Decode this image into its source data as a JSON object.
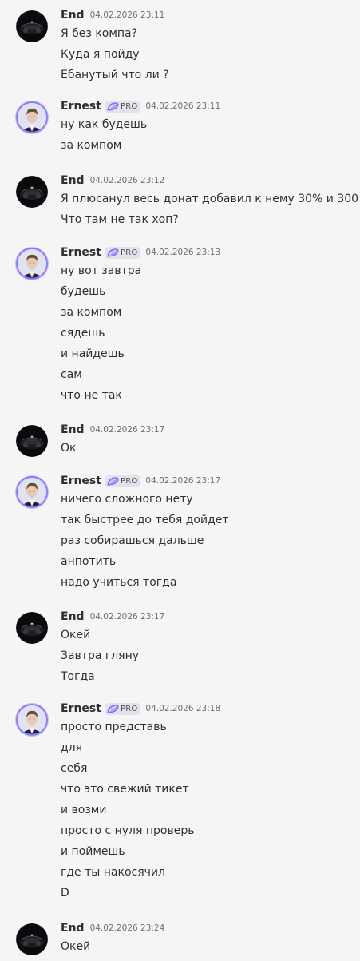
{
  "badge_label": "PRO",
  "messages": [
    {
      "author": "End",
      "timestamp": "04.02.2026 23:11",
      "lines": [
        "Я без компа?",
        "Куда я пойду",
        "Ебанутый что ли ?"
      ]
    },
    {
      "author": "Ernest",
      "pro": true,
      "timestamp": "04.02.2026 23:11",
      "lines": [
        "ну как будешь",
        "за компом"
      ]
    },
    {
      "author": "End",
      "timestamp": "04.02.2026 23:12",
      "lines": [
        "Я плюсанул весь донат добавил к нему 30% и 300",
        "Что там не так хоп?"
      ]
    },
    {
      "author": "Ernest",
      "pro": true,
      "timestamp": "04.02.2026 23:13",
      "lines": [
        "ну вот завтра",
        "будешь",
        "за компом",
        "сядешь",
        "и найдешь",
        "сам",
        "что не так"
      ]
    },
    {
      "author": "End",
      "timestamp": "04.02.2026 23:17",
      "lines": [
        "Ок"
      ]
    },
    {
      "author": "Ernest",
      "pro": true,
      "timestamp": "04.02.2026 23:17",
      "lines": [
        "ничего сложного нету",
        "так быстрее до тебя дойдет",
        "раз собирашься дальше",
        "анпотить",
        "надо учиться тогда"
      ]
    },
    {
      "author": "End",
      "timestamp": "04.02.2026 23:17",
      "lines": [
        "Окей",
        "Завтра гляну",
        "Тогда"
      ]
    },
    {
      "author": "Ernest",
      "pro": true,
      "timestamp": "04.02.2026 23:18",
      "lines": [
        "просто представь",
        "для",
        "себя",
        "что это свежий тикет",
        "и возми",
        "просто с нуля проверь",
        "и поймешь",
        "где ты накосячил",
        "D"
      ]
    },
    {
      "author": "End",
      "timestamp": "04.02.2026 23:24",
      "lines": [
        "Окей"
      ]
    }
  ]
}
